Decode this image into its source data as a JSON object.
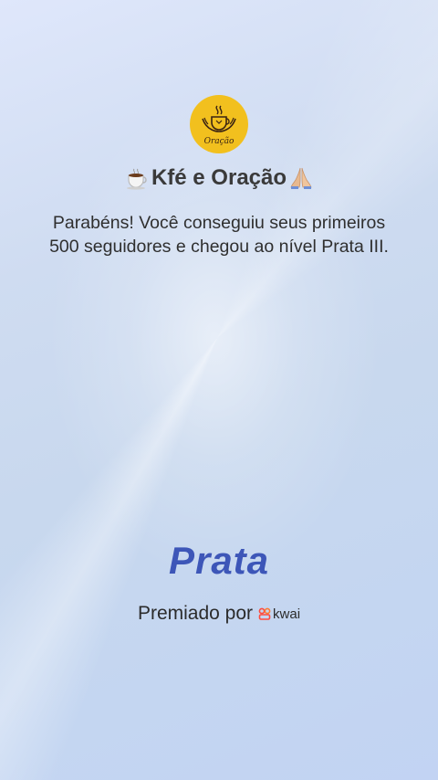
{
  "channel": {
    "logo_text": "Oração",
    "name": "Kfé e Oração",
    "leading_icon": "coffee-cup-icon",
    "trailing_icon": "praying-hands-icon"
  },
  "message": "Parabéns! Você conseguiu seus primeiros 500 seguidores e chegou ao nível Prata III.",
  "level": {
    "label": "Prata",
    "color": "#3d56b8"
  },
  "awarded": {
    "prefix": "Premiado por",
    "brand": "kwai",
    "brand_icon": "kwai-logo-icon",
    "brand_color": "#ff4a3d"
  },
  "colors": {
    "logo_background": "#f2c01e",
    "logo_ink": "#3b2413"
  }
}
